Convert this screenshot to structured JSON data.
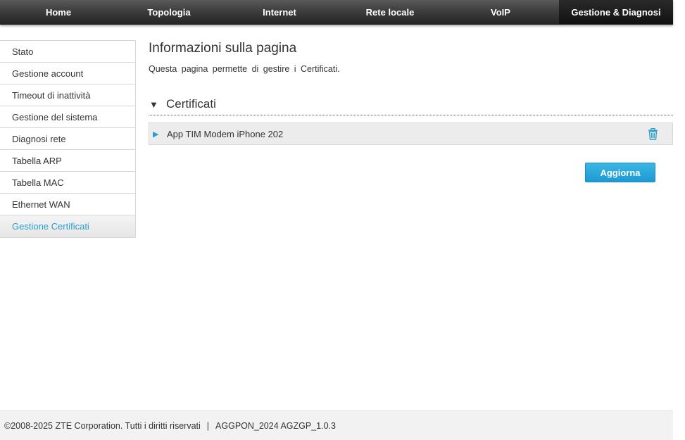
{
  "nav": {
    "tabs": [
      {
        "label": "Home"
      },
      {
        "label": "Topologia"
      },
      {
        "label": "Internet"
      },
      {
        "label": "Rete locale"
      },
      {
        "label": "VoIP"
      },
      {
        "label": "Gestione & Diagnosi",
        "active": true
      }
    ]
  },
  "sidebar": {
    "items": [
      {
        "label": "Stato"
      },
      {
        "label": "Gestione account"
      },
      {
        "label": "Timeout di inattività"
      },
      {
        "label": "Gestione del sistema"
      },
      {
        "label": "Diagnosi rete"
      },
      {
        "label": "Tabella ARP"
      },
      {
        "label": "Tabella MAC"
      },
      {
        "label": "Ethernet WAN"
      },
      {
        "label": "Gestione Certificati",
        "active": true
      }
    ]
  },
  "main": {
    "title": "Informazioni sulla pagina",
    "description": "Questa pagina permette di gestire i Certificati.",
    "section": {
      "title": "Certificati",
      "expanded": true,
      "certificates": [
        {
          "name": "App TIM Modem iPhone 202"
        }
      ]
    },
    "update_button": "Aggiorna"
  },
  "footer": {
    "copyright": "©2008-2025 ZTE Corporation. Tutti i diritti riservati",
    "separator": "|",
    "version": "AGGPON_2024 AGZGP_1.0.3"
  },
  "colors": {
    "accent": "#2a9fd0",
    "nav_bg": "#3e3e3e",
    "button": "#1c9ad2"
  },
  "icons": {
    "section_toggle": "triangle-down-icon",
    "row_expand": "triangle-right-icon",
    "delete": "trash-icon"
  }
}
